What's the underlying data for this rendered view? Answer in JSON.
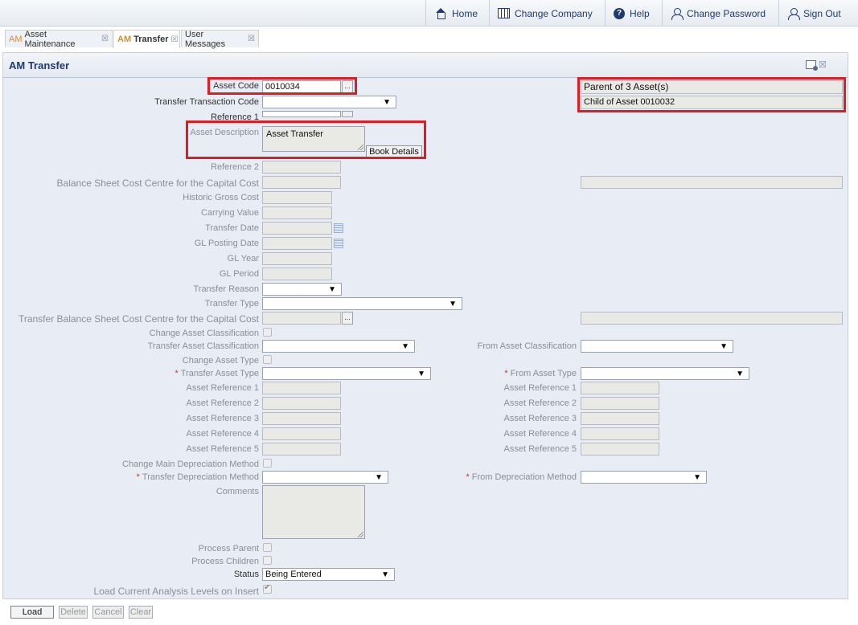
{
  "nav": {
    "home": "Home",
    "change_company": "Change Company",
    "help": "Help",
    "change_password": "Change Password",
    "sign_out": "Sign Out"
  },
  "tabs": [
    {
      "prefix": "AM",
      "label": "Asset Maintenance"
    },
    {
      "prefix": "AM",
      "label": "Transfer"
    },
    {
      "prefix": "",
      "label": "User Messages"
    }
  ],
  "tab_close": "☒",
  "panel": {
    "title": "AM Transfer"
  },
  "form": {
    "asset_code": {
      "label": "Asset Code",
      "value": "0010034"
    },
    "transfer_transaction_code": {
      "label": "Transfer Transaction Code",
      "value": ""
    },
    "reference_1": {
      "label": "Reference 1",
      "value": ""
    },
    "asset_description": {
      "label": "Asset Description",
      "value": "Asset Transfer"
    },
    "book_details": "Book Details",
    "reference_2": {
      "label": "Reference 2",
      "value": ""
    },
    "bs_cost_centre": {
      "label": "Balance Sheet Cost Centre for the Capital Cost",
      "value": ""
    },
    "historic_gross_cost": {
      "label": "Historic Gross Cost",
      "value": ""
    },
    "carrying_value": {
      "label": "Carrying Value",
      "value": ""
    },
    "transfer_date": {
      "label": "Transfer Date",
      "value": ""
    },
    "gl_posting_date": {
      "label": "GL Posting Date",
      "value": ""
    },
    "gl_year": {
      "label": "GL Year",
      "value": ""
    },
    "gl_period": {
      "label": "GL Period",
      "value": ""
    },
    "transfer_reason": {
      "label": "Transfer Reason",
      "value": ""
    },
    "transfer_type": {
      "label": "Transfer Type",
      "value": ""
    },
    "transfer_bs_cost_centre": {
      "label": "Transfer Balance Sheet Cost Centre for the Capital Cost",
      "value": ""
    },
    "change_asset_classification": {
      "label": "Change Asset Classification"
    },
    "transfer_asset_classification": {
      "label": "Transfer Asset Classification",
      "value": ""
    },
    "from_asset_classification": {
      "label": "From Asset Classification",
      "value": ""
    },
    "change_asset_type": {
      "label": "Change Asset Type"
    },
    "transfer_asset_type": {
      "label": "Transfer Asset Type",
      "value": ""
    },
    "from_asset_type": {
      "label": "From Asset Type",
      "value": ""
    },
    "asset_reference_1": {
      "label": "Asset Reference 1",
      "value": ""
    },
    "asset_reference_2": {
      "label": "Asset Reference 2",
      "value": ""
    },
    "asset_reference_3": {
      "label": "Asset Reference 3",
      "value": ""
    },
    "asset_reference_4": {
      "label": "Asset Reference 4",
      "value": ""
    },
    "asset_reference_5": {
      "label": "Asset Reference 5",
      "value": ""
    },
    "from_asset_reference_1": {
      "label": "Asset Reference 1",
      "value": ""
    },
    "from_asset_reference_2": {
      "label": "Asset Reference 2",
      "value": ""
    },
    "from_asset_reference_3": {
      "label": "Asset Reference 3",
      "value": ""
    },
    "from_asset_reference_4": {
      "label": "Asset Reference 4",
      "value": ""
    },
    "from_asset_reference_5": {
      "label": "Asset Reference 5",
      "value": ""
    },
    "change_main_depreciation_method": {
      "label": "Change Main Depreciation Method"
    },
    "transfer_depreciation_method": {
      "label": "Transfer Depreciation Method",
      "value": ""
    },
    "from_depreciation_method": {
      "label": "From Depreciation Method",
      "value": ""
    },
    "comments": {
      "label": "Comments",
      "value": ""
    },
    "process_parent": {
      "label": "Process Parent"
    },
    "process_children": {
      "label": "Process Children"
    },
    "status": {
      "label": "Status",
      "value": "Being Entered"
    },
    "load_current_analysis": {
      "label": "Load Current Analysis Levels on Insert"
    }
  },
  "info": {
    "parent_of": "Parent of 3 Asset(s)",
    "child_of": "Child of Asset 0010032"
  },
  "icons": {
    "dots": "...",
    "arrow": "▼",
    "req": "*"
  },
  "buttons": {
    "load": "Load",
    "delete": "Delete",
    "cancel": "Cancel",
    "clear": "Clear"
  },
  "colors": {
    "highlight": "#e11b22",
    "accent": "#e58a1f",
    "nav_text": "#1f3a6e"
  }
}
